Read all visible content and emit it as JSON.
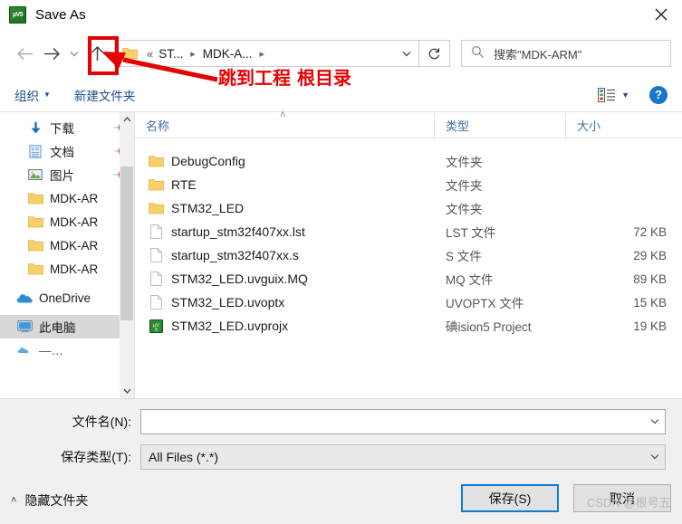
{
  "window": {
    "title": "Save As",
    "app_icon": "uvision5-icon",
    "icon_text": "µV5",
    "close_label": "✕"
  },
  "nav": {
    "back_icon": "arrow-left-icon",
    "forward_icon": "arrow-right-icon",
    "history_caret_icon": "chevron-down-icon",
    "up_icon": "arrow-up-icon",
    "refresh_icon": "refresh-icon",
    "address_dropdown_icon": "chevron-down-icon",
    "folder_icon": "folder-icon",
    "crumb_overflow": "«",
    "breadcrumbs": [
      {
        "label": "ST..."
      },
      {
        "label": "MDK-A..."
      }
    ]
  },
  "search": {
    "icon": "search-icon",
    "placeholder": "搜索\"MDK-ARM\""
  },
  "commandbar": {
    "organize_label": "组织",
    "new_folder_label": "新建文件夹",
    "view_icon": "list-view-icon",
    "view_caret_icon": "chevron-down-icon",
    "help_label": "?",
    "help_icon": "help-icon"
  },
  "navpane": {
    "items": [
      {
        "label": "下载",
        "icon": "download-icon",
        "pinned": true,
        "selected": false
      },
      {
        "label": "文档",
        "icon": "documents-icon",
        "pinned": true,
        "selected": false
      },
      {
        "label": "图片",
        "icon": "pictures-icon",
        "pinned": true,
        "selected": false
      },
      {
        "label": "MDK-AR",
        "icon": "folder-icon",
        "pinned": false,
        "selected": false
      },
      {
        "label": "MDK-AR",
        "icon": "folder-icon",
        "pinned": false,
        "selected": false
      },
      {
        "label": "MDK-AR",
        "icon": "folder-icon",
        "pinned": false,
        "selected": false
      },
      {
        "label": "MDK-AR",
        "icon": "folder-icon",
        "pinned": false,
        "selected": false
      },
      {
        "label": "OneDrive",
        "icon": "onedrive-icon",
        "pinned": false,
        "selected": false
      },
      {
        "label": "此电脑",
        "icon": "this-pc-icon",
        "pinned": false,
        "selected": true
      }
    ],
    "scroll_up_icon": "chevron-up-icon",
    "scroll_down_icon": "chevron-down-icon"
  },
  "filelist": {
    "columns": [
      {
        "label": "名称",
        "key": "name"
      },
      {
        "label": "类型",
        "key": "type"
      },
      {
        "label": "大小",
        "key": "size"
      }
    ],
    "sort_arrow": "˄",
    "rows": [
      {
        "name": "DebugConfig",
        "type": "文件夹",
        "size": "",
        "icon": "folder-icon"
      },
      {
        "name": "RTE",
        "type": "文件夹",
        "size": "",
        "icon": "folder-icon"
      },
      {
        "name": "STM32_LED",
        "type": "文件夹",
        "size": "",
        "icon": "folder-icon"
      },
      {
        "name": "startup_stm32f407xx.lst",
        "type": "LST 文件",
        "size": "72 KB",
        "icon": "file-icon"
      },
      {
        "name": "startup_stm32f407xx.s",
        "type": "S 文件",
        "size": "29 KB",
        "icon": "file-icon"
      },
      {
        "name": "STM32_LED.uvguix.MQ",
        "type": "MQ 文件",
        "size": "89 KB",
        "icon": "file-icon"
      },
      {
        "name": "STM32_LED.uvoptx",
        "type": "UVOPTX 文件",
        "size": "15 KB",
        "icon": "file-icon"
      },
      {
        "name": "STM32_LED.uvprojx",
        "type": "碘ision5 Project",
        "size": "19 KB",
        "icon": "uvision5-icon"
      }
    ]
  },
  "form": {
    "filename_label": "文件名(N):",
    "filename_value": "",
    "filetype_label": "保存类型(T):",
    "filetype_value": "All Files (*.*)",
    "combo_caret_icon": "chevron-down-icon",
    "save_label": "保存(S)",
    "cancel_label": "取消",
    "hide_folders_label": "隐藏文件夹",
    "hide_folders_chevron": "˄"
  },
  "annotations": {
    "callout_text": "跳到工程 根目录",
    "highlight_color": "#e60000",
    "watermark": "CSDN @根号五"
  },
  "colors": {
    "accent": "#0d7bd4",
    "link": "#1b4b8f",
    "annotation": "#e60000",
    "folder": "#f7d069",
    "uvision_green": "#2e8b30"
  }
}
